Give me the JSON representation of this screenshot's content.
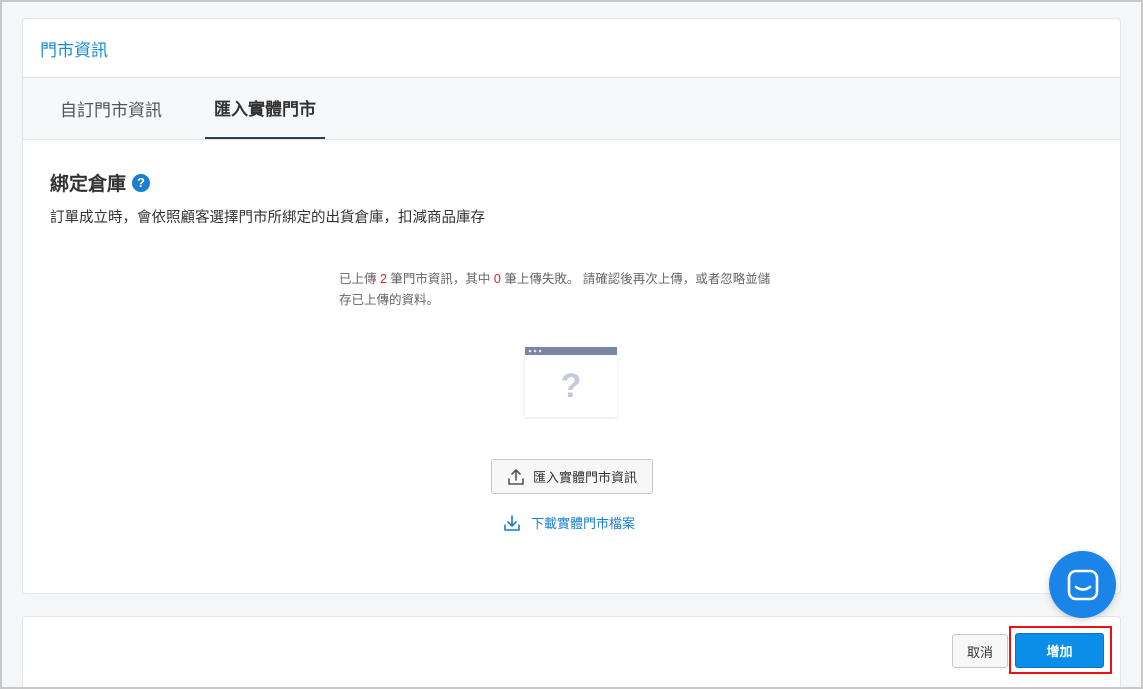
{
  "card": {
    "title": "門市資訊"
  },
  "tabs": [
    {
      "label": "自訂門市資訊",
      "active": false
    },
    {
      "label": "匯入實體門市",
      "active": true
    }
  ],
  "section": {
    "title": "綁定倉庫",
    "help_icon": "question-circle-icon",
    "description": "訂單成立時，會依照顧客選擇門市所綁定的出貨倉庫，扣減商品庫存"
  },
  "upload_status": {
    "part1": "已上傳 ",
    "uploaded_count": "2",
    "part2": " 筆門市資訊，其中 ",
    "failed_count": "0",
    "part3": " 筆上傳失敗。 請確認後再次上傳，或者忽略並儲",
    "part4": "存已上傳的資料。"
  },
  "illustration": {
    "icon": "missing-page-icon",
    "glyph": "?"
  },
  "import_button": {
    "label": "匯入實體門市資訊",
    "icon": "upload-icon"
  },
  "download_link": {
    "label": "下載實體門市檔案",
    "icon": "download-icon"
  },
  "footer": {
    "cancel_label": "取消",
    "add_label": "增加"
  },
  "chat": {
    "icon": "chat-icon"
  },
  "colors": {
    "accent": "#1a7fd0",
    "primary_button": "#0a8ee8",
    "error_count": "#e02020",
    "highlight": "#ee1111"
  }
}
